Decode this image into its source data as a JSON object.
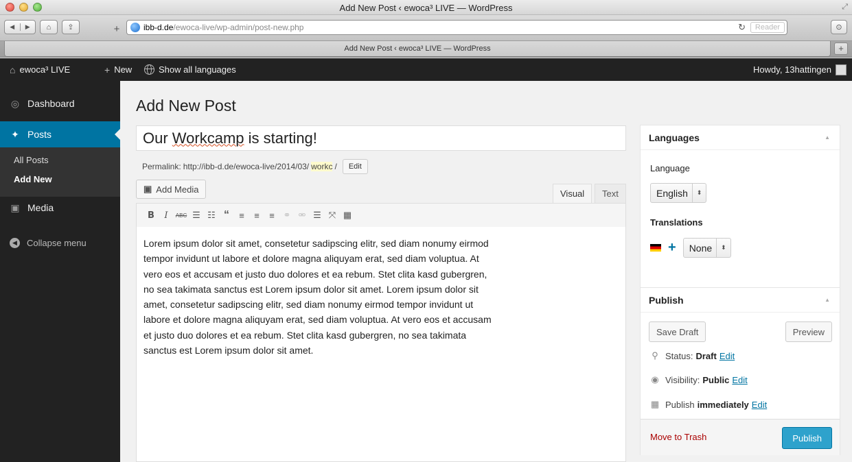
{
  "browser": {
    "window_title": "Add New Post ‹ ewoca³ LIVE — WordPress",
    "tab_title": "Add New Post ‹ ewoca³ LIVE — WordPress",
    "url_host": "ibb-d.de",
    "url_path": "/ewoca-live/wp-admin/post-new.php",
    "reader_label": "Reader"
  },
  "adminbar": {
    "site_name": "ewoca³ LIVE",
    "new_label": "New",
    "languages_label": "Show all languages",
    "howdy": "Howdy, 13hattingen"
  },
  "sidebar": {
    "dashboard": "Dashboard",
    "posts": "Posts",
    "all_posts": "All Posts",
    "add_new": "Add New",
    "media": "Media",
    "collapse": "Collapse menu"
  },
  "page": {
    "title": "Add New Post",
    "post_title_a": "Our ",
    "post_title_b": "Workcamp",
    "post_title_c": " is starting!",
    "permalink_label": "Permalink:",
    "permalink_base": "http://ibb-d.de/ewoca-live/2014/03/",
    "permalink_slug": "workc",
    "permalink_end": "/",
    "permalink_edit": "Edit",
    "add_media": "Add Media",
    "tab_visual": "Visual",
    "tab_text": "Text",
    "body": "Lorem ipsum dolor sit amet, consetetur sadipscing elitr, sed diam nonumy eirmod tempor invidunt ut labore et dolore magna aliquyam erat, sed diam voluptua. At vero eos et accusam et justo duo dolores et ea rebum. Stet clita kasd gubergren, no sea takimata sanctus est Lorem ipsum dolor sit amet. Lorem ipsum dolor sit amet, consetetur sadipscing elitr, sed diam nonumy eirmod tempor invidunt ut labore et dolore magna aliquyam erat, sed diam voluptua. At vero eos et accusam et justo duo dolores et ea rebum. Stet clita kasd gubergren, no sea takimata sanctus est Lorem ipsum dolor sit amet."
  },
  "editor_toolbar": [
    "bold-icon",
    "italic-icon",
    "strikethrough-icon",
    "bullet-list-icon",
    "numbered-list-icon",
    "blockquote-icon",
    "align-left-icon",
    "align-center-icon",
    "align-right-icon",
    "link-icon",
    "unlink-icon",
    "read-more-icon",
    "fullscreen-icon",
    "kitchen-sink-icon"
  ],
  "languages_box": {
    "title": "Languages",
    "language_label": "Language",
    "language_value": "English",
    "translations_label": "Translations",
    "translation_value": "None"
  },
  "publish_box": {
    "title": "Publish",
    "save_draft": "Save Draft",
    "preview": "Preview",
    "status_label": "Status:",
    "status_value": "Draft",
    "visibility_label": "Visibility:",
    "visibility_value": "Public",
    "publish_label": "Publish",
    "publish_value": "immediately",
    "edit_link": "Edit",
    "trash": "Move to Trash",
    "publish_button": "Publish"
  },
  "colors": {
    "admin_bar": "#222222",
    "accent": "#0074a2",
    "publish_button": "#2ea2cc",
    "trash": "#aa0000"
  }
}
